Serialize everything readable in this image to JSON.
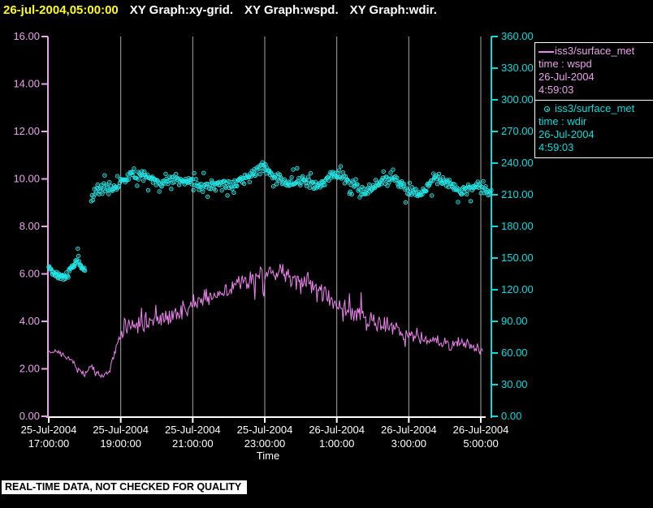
{
  "title": {
    "timestamp": "26-jul-2004,05:00:00",
    "graphs": [
      "XY Graph:xy-grid.",
      "XY Graph:wspd.",
      "XY Graph:wdir."
    ]
  },
  "banner": "REAL-TIME DATA, NOT CHECKED FOR QUALITY",
  "colors": {
    "background": "#000000",
    "title_timestamp": "#ffff00",
    "title_text": "#ffffff",
    "wspd": "#ee85ee",
    "wspd_axis": "#e9a3e9",
    "wdir": "#22e6e6",
    "wdir_axis": "#00dcdc",
    "grid": "#a8a8a8",
    "x_axis": "#ffffff",
    "banner_bg": "#ffffff",
    "banner_text": "#000000"
  },
  "legend": {
    "entries": [
      {
        "id": "wspd",
        "symbol": "line",
        "name": "iss3/surface_met",
        "field": "time : wspd",
        "date": "26-Jul-2004",
        "clock": "4:59:03"
      },
      {
        "id": "wdir",
        "symbol": "circle",
        "name": "iss3/surface_met",
        "field": "time : wdir",
        "date": "26-Jul-2004",
        "clock": "4:59:03"
      }
    ]
  },
  "chart_data": {
    "type": "line",
    "title": "",
    "xlabel": "Time",
    "grid": "vertical-only",
    "legend_position": "right-outside",
    "x_axis": {
      "range_hours": [
        0,
        12
      ],
      "tick_interval_hours": 2,
      "ticks": [
        {
          "date": "25-Jul-2004",
          "time": "17:00:00"
        },
        {
          "date": "25-Jul-2004",
          "time": "19:00:00"
        },
        {
          "date": "25-Jul-2004",
          "time": "21:00:00"
        },
        {
          "date": "25-Jul-2004",
          "time": "23:00:00"
        },
        {
          "date": "26-Jul-2004",
          "time": "1:00:00"
        },
        {
          "date": "26-Jul-2004",
          "time": "3:00:00"
        },
        {
          "date": "26-Jul-2004",
          "time": "5:00:00"
        }
      ]
    },
    "left_axis": {
      "series": "wspd",
      "range": [
        0,
        16
      ],
      "tick_step": 2,
      "tick_labels": [
        "0.00",
        "2.00",
        "4.00",
        "6.00",
        "8.00",
        "10.00",
        "12.00",
        "14.00",
        "16.00"
      ]
    },
    "right_axis": {
      "series": "wdir",
      "range": [
        0,
        360
      ],
      "tick_step": 30,
      "tick_labels": [
        "0.00",
        "30.00",
        "60.00",
        "90.00",
        "120.00",
        "150.00",
        "180.00",
        "210.00",
        "240.00",
        "270.00",
        "300.00",
        "330.00",
        "360.00"
      ]
    },
    "series": [
      {
        "id": "wspd",
        "name": "iss3/surface_met time : wspd",
        "axis": "left",
        "style": "line",
        "color": "#ee85ee",
        "seed": 13,
        "noise_anchors": [
          [
            0,
            0.12
          ],
          [
            1.6,
            0.15
          ],
          [
            2.1,
            0.32
          ],
          [
            3.0,
            0.4
          ],
          [
            4.5,
            0.45
          ],
          [
            6.0,
            0.5
          ],
          [
            8.0,
            0.45
          ],
          [
            10.0,
            0.4
          ],
          [
            12.05,
            0.32
          ]
        ],
        "segments": [
          {
            "t0": 0,
            "t1": 12.05,
            "step": 0.025,
            "anchors": [
              [
                0,
                2.75
              ],
              [
                0.35,
                2.65
              ],
              [
                0.6,
                2.4
              ],
              [
                0.85,
                1.95
              ],
              [
                1.0,
                1.75
              ],
              [
                1.15,
                2.1
              ],
              [
                1.3,
                1.9
              ],
              [
                1.5,
                1.65
              ],
              [
                1.7,
                1.95
              ],
              [
                1.85,
                2.8
              ],
              [
                2.0,
                3.5
              ],
              [
                2.2,
                3.8
              ],
              [
                2.6,
                3.9
              ],
              [
                3.0,
                4.1
              ],
              [
                3.4,
                4.3
              ],
              [
                3.8,
                4.5
              ],
              [
                4.2,
                4.9
              ],
              [
                4.6,
                5.1
              ],
              [
                5.0,
                5.4
              ],
              [
                5.4,
                5.7
              ],
              [
                5.8,
                5.95
              ],
              [
                6.1,
                6.05
              ],
              [
                6.5,
                6.0
              ],
              [
                6.9,
                5.8
              ],
              [
                7.3,
                5.5
              ],
              [
                7.7,
                5.1
              ],
              [
                8.0,
                4.65
              ],
              [
                8.4,
                4.4
              ],
              [
                8.8,
                4.2
              ],
              [
                9.2,
                3.9
              ],
              [
                9.6,
                3.7
              ],
              [
                10.0,
                3.4
              ],
              [
                10.4,
                3.3
              ],
              [
                10.8,
                3.15
              ],
              [
                11.2,
                3.0
              ],
              [
                11.6,
                3.1
              ],
              [
                12.05,
                2.8
              ]
            ]
          }
        ]
      },
      {
        "id": "wdir",
        "name": "iss3/surface_met time : wdir",
        "axis": "right",
        "style": "scatter",
        "color": "#22e6e6",
        "seed": 29,
        "noise_anchors": [
          [
            0,
            4.5
          ],
          [
            1.02,
            4.5
          ],
          [
            1.18,
            6
          ],
          [
            12.3,
            6
          ]
        ],
        "segments": [
          {
            "t0": 0,
            "t1": 1.02,
            "step": 0.0165,
            "anchors": [
              [
                0,
                140
              ],
              [
                0.2,
                135
              ],
              [
                0.4,
                132
              ],
              [
                0.55,
                135
              ],
              [
                0.7,
                145
              ],
              [
                0.8,
                151
              ],
              [
                0.92,
                141
              ],
              [
                1.02,
                137
              ]
            ]
          },
          {
            "t0": 1.18,
            "t1": 12.3,
            "step": 0.022,
            "anchors": [
              [
                1.18,
                206
              ],
              [
                1.35,
                214
              ],
              [
                1.6,
                217
              ],
              [
                1.9,
                219
              ],
              [
                2.15,
                225
              ],
              [
                2.35,
                231
              ],
              [
                2.6,
                228
              ],
              [
                2.9,
                224
              ],
              [
                3.2,
                221
              ],
              [
                3.5,
                225
              ],
              [
                3.8,
                222
              ],
              [
                4.1,
                219
              ],
              [
                4.4,
                217
              ],
              [
                4.7,
                222
              ],
              [
                5.0,
                220
              ],
              [
                5.3,
                222
              ],
              [
                5.6,
                228
              ],
              [
                5.85,
                237
              ],
              [
                6.05,
                233
              ],
              [
                6.3,
                226
              ],
              [
                6.6,
                221
              ],
              [
                6.9,
                224
              ],
              [
                7.2,
                222
              ],
              [
                7.5,
                219
              ],
              [
                7.8,
                226
              ],
              [
                8.05,
                230
              ],
              [
                8.3,
                224
              ],
              [
                8.6,
                216
              ],
              [
                8.9,
                214
              ],
              [
                9.2,
                221
              ],
              [
                9.5,
                227
              ],
              [
                9.8,
                220
              ],
              [
                10.05,
                212
              ],
              [
                10.3,
                210
              ],
              [
                10.55,
                218
              ],
              [
                10.8,
                226
              ],
              [
                11.05,
                222
              ],
              [
                11.3,
                216
              ],
              [
                11.55,
                213
              ],
              [
                11.8,
                218
              ],
              [
                12.3,
                212
              ]
            ]
          }
        ]
      }
    ]
  }
}
